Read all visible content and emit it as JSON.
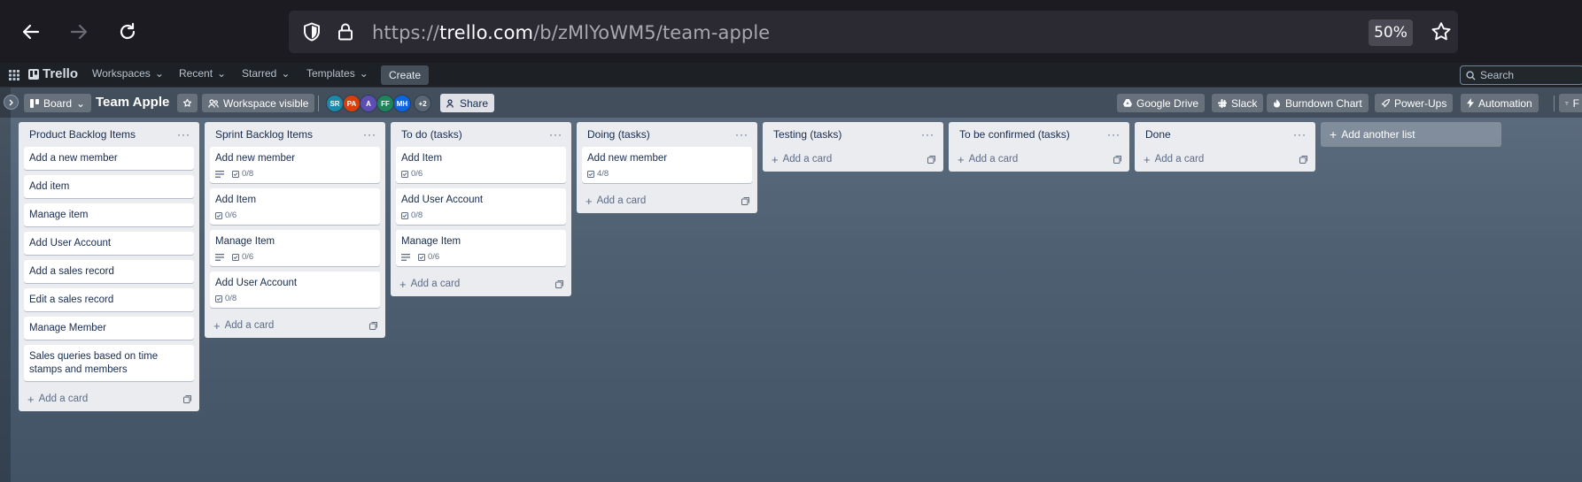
{
  "browser": {
    "url_prefix": "https://",
    "url_host": "trello.com",
    "url_path": "/b/zMlYoWM5/team-apple",
    "zoom": "50%",
    "icons": [
      "back-icon",
      "forward-icon",
      "reload-icon",
      "shield-icon",
      "lock-icon",
      "star-icon"
    ]
  },
  "header": {
    "logo_text": "Trello",
    "menus": [
      "Workspaces",
      "Recent",
      "Starred",
      "Templates"
    ],
    "create_label": "Create",
    "search_placeholder": "Search"
  },
  "board": {
    "view_label": "Board",
    "title": "Team Apple",
    "visibility_label": "Workspace visible",
    "share_label": "Share",
    "members": [
      {
        "initials": "SR",
        "color": "#1e88a8"
      },
      {
        "initials": "PA",
        "color": "#d93f0b"
      },
      {
        "initials": "A",
        "color": "#5e4db2"
      },
      {
        "initials": "FF",
        "color": "#1f845a"
      },
      {
        "initials": "MH",
        "color": "#0c66e4"
      }
    ],
    "more_members": "+2",
    "powerups": [
      "Google Drive",
      "Slack",
      "Burndown Chart",
      "Power-Ups",
      "Automation"
    ],
    "filter_label": "F"
  },
  "lists": [
    {
      "title": "Product Backlog Items",
      "cards": [
        {
          "title": "Add a new member"
        },
        {
          "title": "Add item"
        },
        {
          "title": "Manage item"
        },
        {
          "title": "Add User Account"
        },
        {
          "title": "Add a sales record"
        },
        {
          "title": "Edit a sales record"
        },
        {
          "title": "Manage Member"
        },
        {
          "title": "Sales queries based on time stamps and members"
        }
      ]
    },
    {
      "title": "Sprint Backlog Items",
      "cards": [
        {
          "title": "Add new member",
          "description": true,
          "checklist": "0/8"
        },
        {
          "title": "Add Item",
          "checklist": "0/6"
        },
        {
          "title": "Manage Item",
          "description": true,
          "checklist": "0/6"
        },
        {
          "title": "Add User Account",
          "checklist": "0/8"
        }
      ]
    },
    {
      "title": "To do (tasks)",
      "cards": [
        {
          "title": "Add Item",
          "checklist": "0/6"
        },
        {
          "title": "Add User Account",
          "checklist": "0/8"
        },
        {
          "title": "Manage Item",
          "description": true,
          "checklist": "0/6"
        }
      ]
    },
    {
      "title": "Doing (tasks)",
      "cards": [
        {
          "title": "Add new member",
          "checklist": "4/8"
        }
      ]
    },
    {
      "title": "Testing (tasks)",
      "cards": []
    },
    {
      "title": "To be confirmed (tasks)",
      "cards": []
    },
    {
      "title": "Done",
      "cards": []
    }
  ],
  "add_card_label": "Add a card",
  "add_list_label": "Add another list",
  "list_menu_glyph": "···"
}
